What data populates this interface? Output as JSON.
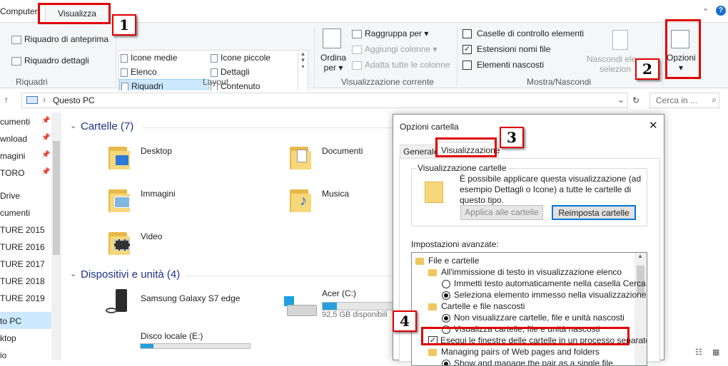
{
  "ribbon_tabs": {
    "computer": "Computer",
    "visualizza": "Visualizza"
  },
  "riquadri": {
    "anteprima": "Riquadro di anteprima",
    "dettagli": "Riquadro dettagli",
    "label": "Riquadri"
  },
  "layout": {
    "icone_medie": "Icone medie",
    "elenco": "Elenco",
    "riquadri": "Riquadri",
    "icone_piccole": "Icone piccole",
    "dettagli": "Dettagli",
    "contenuto": "Contenuto",
    "label": "Layout"
  },
  "vista_corrente": {
    "ordina": "Ordina",
    "per": "per",
    "raggruppa": "Raggruppa per",
    "aggiungi": "Aggiungi colonne",
    "adatta": "Adatta tutte le colonne",
    "label": "Visualizzazione corrente"
  },
  "mostra": {
    "caselle": "Caselle di controllo elementi",
    "estensioni": "Estensioni nomi file",
    "nascosti": "Elementi nascosti",
    "nascondi_a": "Nascondi ele",
    "nascondi_b": "selezion",
    "label": "Mostra/Nascondi",
    "opzioni": "Opzioni"
  },
  "address": {
    "path": "Questo PC",
    "search_placeholder": "Cerca in ..."
  },
  "nav": [
    "cumenti",
    "wnload",
    "magini",
    "TORO",
    "Drive",
    "cumenti",
    "TURE 2015",
    "TURE 2016",
    "TURE 2017",
    "TURE 2018",
    "TURE 2019",
    "to PC",
    "ktop",
    "io"
  ],
  "sections": {
    "cartelle": "Cartelle (7)",
    "dispositivi": "Dispositivi e unità (4)"
  },
  "folders": {
    "desktop": "Desktop",
    "documenti": "Documenti",
    "immagini": "Immagini",
    "musica": "Musica",
    "video": "Video"
  },
  "devices": {
    "samsung": "Samsung Galaxy S7 edge",
    "acer": "Acer (C:)",
    "acer_free": "92,5 GB disponibili",
    "disco": "Disco locale (E:)"
  },
  "dialog": {
    "title": "Opzioni cartella",
    "tab_generale": "Generale",
    "tab_visualizzazione": "Visualizzazione",
    "fs_title": "Visualizzazione cartelle",
    "fs_text": "È possibile applicare questa visualizzazione (ad esempio Dettagli o Icone) a tutte le cartelle di questo tipo.",
    "btn_applica": "Applica alle cartelle",
    "btn_reimposta": "Reimposta cartelle",
    "avanzate": "Impostazioni avanzate:",
    "tree": [
      "File e cartelle",
      "All'immissione di testo in visualizzazione elenco",
      "Immetti testo automaticamente nella casella Cerca",
      "Seleziona elemento immesso nella visualizzazione",
      "Cartelle e file nascosti",
      "Non visualizzare cartelle, file e unità nascosti",
      "Visualizza cartelle, file e unità nascosti",
      "Esegui le finestre delle cartelle in un processo separato",
      "Managing pairs of Web pages and folders",
      "Show and manage the pair as a single file"
    ]
  },
  "badges": [
    "1",
    "2",
    "3",
    "4"
  ],
  "drive_usage": {
    "acer_used_fraction": 0.1,
    "disco_used_fraction": 0.12
  },
  "colors": {
    "annotation_red": "#e00000",
    "section_blue": "#1e3287",
    "selection": "#cce8ff"
  }
}
